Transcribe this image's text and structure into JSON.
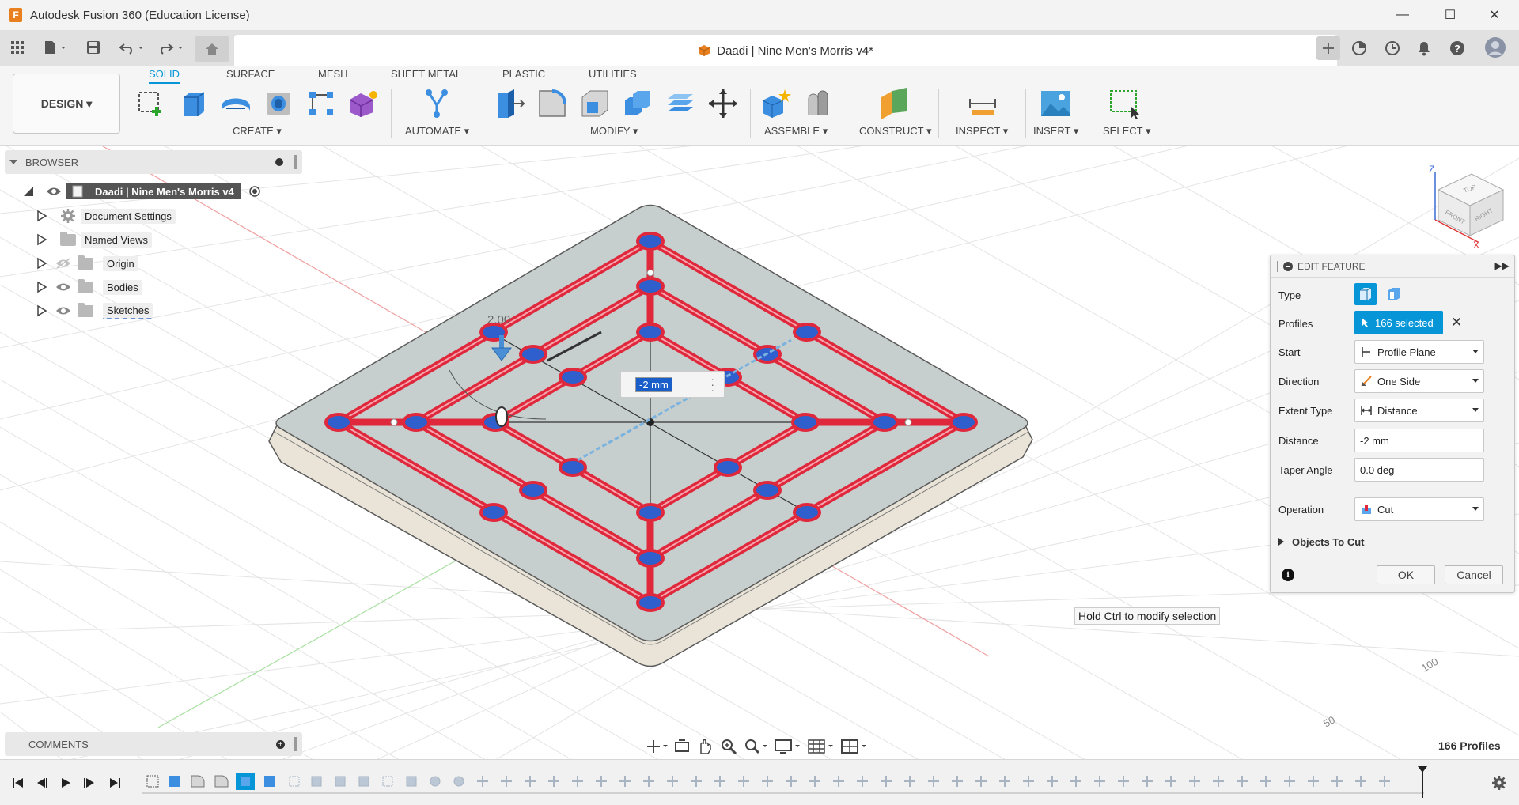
{
  "window": {
    "title": "Autodesk Fusion 360 (Education License)",
    "minimize": "—",
    "maximize": "☐",
    "close": "✕"
  },
  "document_tab": {
    "title": "Daadi | Nine Men's Morris v4*",
    "close": "✕"
  },
  "toolbar": {
    "workspace": "DESIGN ▾",
    "tabs": [
      "SOLID",
      "SURFACE",
      "MESH",
      "SHEET METAL",
      "PLASTIC",
      "UTILITIES"
    ],
    "active_tab": "SOLID",
    "groups": [
      "CREATE ▾",
      "AUTOMATE ▾",
      "MODIFY ▾",
      "ASSEMBLE ▾",
      "CONSTRUCT ▾",
      "INSPECT ▾",
      "INSERT ▾",
      "SELECT ▾"
    ]
  },
  "browser": {
    "header": "BROWSER",
    "root": "Daadi | Nine Men's Morris v4",
    "items": [
      "Document Settings",
      "Named Views",
      "Origin",
      "Bodies",
      "Sketches"
    ]
  },
  "viewport": {
    "dimension_label": "2.00",
    "distance_input": "-2 mm",
    "tooltip": "Hold Ctrl to modify selection",
    "status": "166 Profiles",
    "grid_labels": [
      "100",
      "50"
    ],
    "viewcube": {
      "top": "TOP",
      "front": "FRONT",
      "right": "RIGHT",
      "z": "Z",
      "x": "X"
    }
  },
  "edit_feature": {
    "header": "EDIT FEATURE",
    "type_label": "Type",
    "profiles_label": "Profiles",
    "profiles_value": "166 selected",
    "start_label": "Start",
    "start_value": "Profile Plane",
    "direction_label": "Direction",
    "direction_value": "One Side",
    "extent_label": "Extent Type",
    "extent_value": "Distance",
    "distance_label": "Distance",
    "distance_value": "-2 mm",
    "taper_label": "Taper Angle",
    "taper_value": "0.0 deg",
    "operation_label": "Operation",
    "operation_value": "Cut",
    "objects_label": "Objects To Cut",
    "ok": "OK",
    "cancel": "Cancel"
  },
  "comments": {
    "header": "COMMENTS"
  },
  "colors": {
    "accent": "#0696d7",
    "profile_red": "#e0283c",
    "profile_blue": "#2e5fcc",
    "board_face": "#c6cfcd",
    "board_edge": "#e9e4d7"
  }
}
